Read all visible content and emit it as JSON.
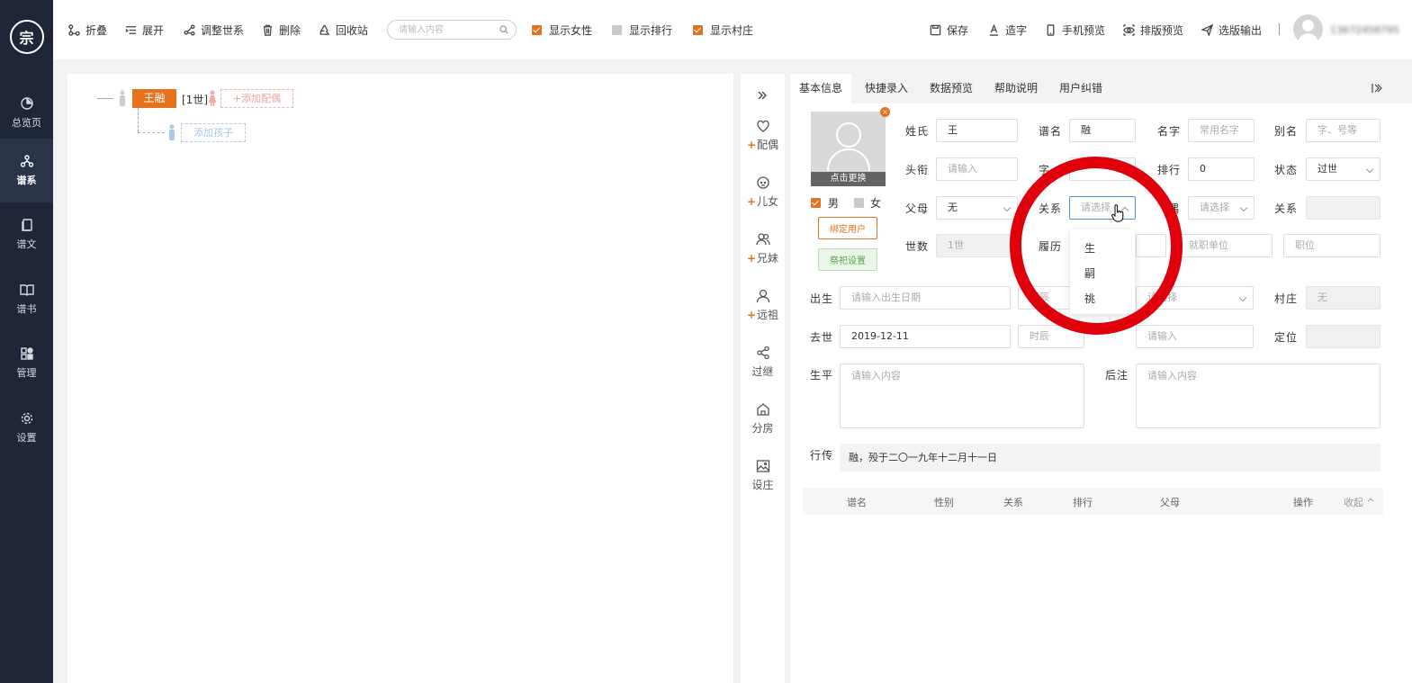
{
  "app": {
    "logo_text": "宗"
  },
  "sidebar": {
    "items": [
      {
        "label": "总览页",
        "icon": "pie-chart-icon"
      },
      {
        "label": "谱系",
        "icon": "tree-icon"
      },
      {
        "label": "谱文",
        "icon": "document-icon"
      },
      {
        "label": "谱书",
        "icon": "book-icon"
      },
      {
        "label": "管理",
        "icon": "grid-icon"
      },
      {
        "label": "设置",
        "icon": "gear-icon"
      }
    ]
  },
  "toolbar": {
    "fold": "折叠",
    "expand": "展开",
    "adjust": "调整世系",
    "delete": "删除",
    "recycle": "回收站",
    "search_placeholder": "请输入内容",
    "show_female": "显示女性",
    "show_rank": "显示排行",
    "show_village": "显示村庄",
    "save": "保存",
    "make_char": "造字",
    "mobile_preview": "手机预览",
    "layout_preview": "排版预览",
    "export": "选版输出",
    "username": "13672458795"
  },
  "tree": {
    "name": "王融",
    "gen": "[1世]",
    "add_spouse": "+添加配偶",
    "add_child": "添加孩子"
  },
  "side_actions": [
    {
      "label": "配偶",
      "plus": "+"
    },
    {
      "label": "儿女",
      "plus": "+"
    },
    {
      "label": "兄妹",
      "plus": "+"
    },
    {
      "label": "远祖",
      "plus": "+"
    },
    {
      "label": "过继",
      "plus": ""
    },
    {
      "label": "分房",
      "plus": ""
    },
    {
      "label": "设庄",
      "plus": ""
    }
  ],
  "tabs": [
    "基本信息",
    "快捷录入",
    "数据预览",
    "帮助说明",
    "用户纠错"
  ],
  "form": {
    "photo_change": "点击更换",
    "male": "男",
    "female": "女",
    "bind_user": "绑定用户",
    "sacrifice": "祭祀设置",
    "surname_l": "姓氏",
    "surname": "王",
    "puming_l": "谱名",
    "puming": "融",
    "mingzi_l": "名字",
    "mingzi_ph": "常用名字",
    "bieming_l": "别名",
    "bieming_ph": "字、号等",
    "touxian_l": "头衔",
    "touxian_ph": "请输入",
    "zi_l": "字",
    "paihang_l": "排行",
    "paihang": "0",
    "status_l": "状态",
    "status": "过世",
    "parents_l": "父母",
    "parents": "无",
    "relation_l": "关系",
    "relation_ph": "请选择",
    "spouse_l": "偶",
    "spouse_ph": "请选择",
    "relation2_l": "关系",
    "shishu_l": "世数",
    "shishu": "1世",
    "lvli_l": "履历",
    "unit_ph": "就职单位",
    "post_ph": "职位",
    "birth_l": "出生",
    "birth_ph": "请输入出生日期",
    "time_ph": "时辰",
    "select_ph": "请选择",
    "village_l": "村庄",
    "village": "无",
    "death_l": "去世",
    "death": "2019-12-11",
    "death_time_ph": "时辰",
    "death_place_ph": "请输入",
    "locate_l": "定位",
    "life_l": "生平",
    "life_ph": "请输入内容",
    "postnote_l": "后注",
    "postnote_ph": "请输入内容",
    "xingzhuan_l": "行传",
    "xingzhuan": "融，殁于二〇一九年十二月十一日"
  },
  "dropdown": [
    "生",
    "嗣",
    "祧"
  ],
  "table": {
    "headers": [
      "谱名",
      "性别",
      "关系",
      "排行",
      "父母",
      "操作"
    ],
    "collapse": "收起"
  }
}
